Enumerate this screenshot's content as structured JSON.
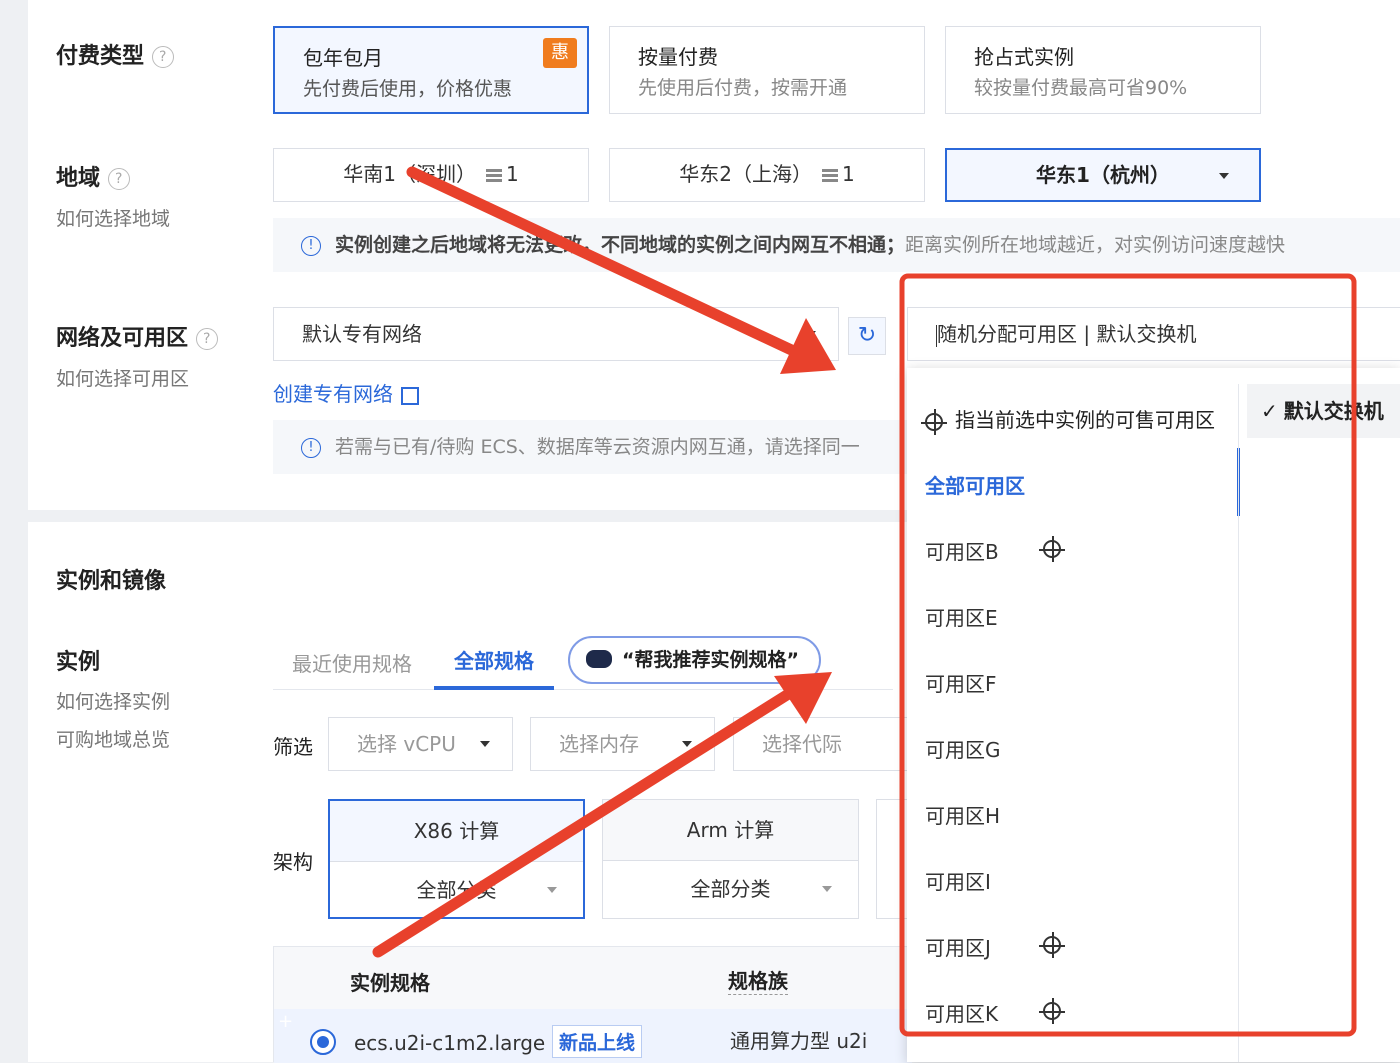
{
  "billing": {
    "label": "付费类型",
    "options": [
      {
        "title": "包年包月",
        "desc": "先付费后使用，价格优惠",
        "badge": "惠"
      },
      {
        "title": "按量付费",
        "desc": "先使用后付费，按需开通"
      },
      {
        "title": "抢占式实例",
        "desc": "较按量付费最高可省90%"
      }
    ]
  },
  "region": {
    "label": "地域",
    "help": "如何选择地域",
    "options": [
      {
        "name": "华南1（深圳）",
        "count": "1"
      },
      {
        "name": "华东2（上海）",
        "count": "1"
      },
      {
        "name": "华东1（杭州）"
      }
    ],
    "notice_bold": "实例创建之后地域将无法更改，不同地域的实例之间内网互不相通；",
    "notice_rest": "距离实例所在地域越近，对实例访问速度越快"
  },
  "network": {
    "label": "网络及可用区",
    "help": "如何选择可用区",
    "vpc_value": "默认专有网络",
    "create_vpc_link": "创建专有网络",
    "zone_value": "随机分配可用区 | 默认交换机",
    "notice": "若需与已有/待购 ECS、数据库等云资源内网互通，请选择同一"
  },
  "zone_dropdown": {
    "hint": "指当前选中实例的可售可用区",
    "all_label": "全部可用区",
    "zones": [
      {
        "name": "可用区B",
        "icon": "crosshair-icon"
      },
      {
        "name": "可用区E"
      },
      {
        "name": "可用区F"
      },
      {
        "name": "可用区G"
      },
      {
        "name": "可用区H"
      },
      {
        "name": "可用区I"
      },
      {
        "name": "可用区J",
        "icon": "crosshair-icon"
      },
      {
        "name": "可用区K",
        "icon": "crosshair-icon"
      }
    ],
    "switch_option": "默认交换机"
  },
  "instance_section": {
    "title": "实例和镜像",
    "instance_label": "实例",
    "help1": "如何选择实例",
    "help2": "可购地域总览",
    "tabs": [
      "最近使用规格",
      "全部规格"
    ],
    "ai_button": "“帮我推荐实例规格”",
    "filter_label": "筛选",
    "filters": [
      "选择 vCPU",
      "选择内存",
      "选择代际"
    ],
    "arch_label": "架构",
    "archs": [
      {
        "name": "X86 计算",
        "category": "全部分类"
      },
      {
        "name": "Arm 计算",
        "category": "全部分类"
      }
    ],
    "table_headers": [
      "实例规格",
      "规格族"
    ],
    "row": {
      "spec": "ecs.u2i-c1m2.large",
      "badge": "新品上线",
      "family": "通用算力型 u2i"
    }
  },
  "colors": {
    "accent": "#2b68d9",
    "badge": "#f07c1e",
    "annotation": "#e8412c"
  }
}
